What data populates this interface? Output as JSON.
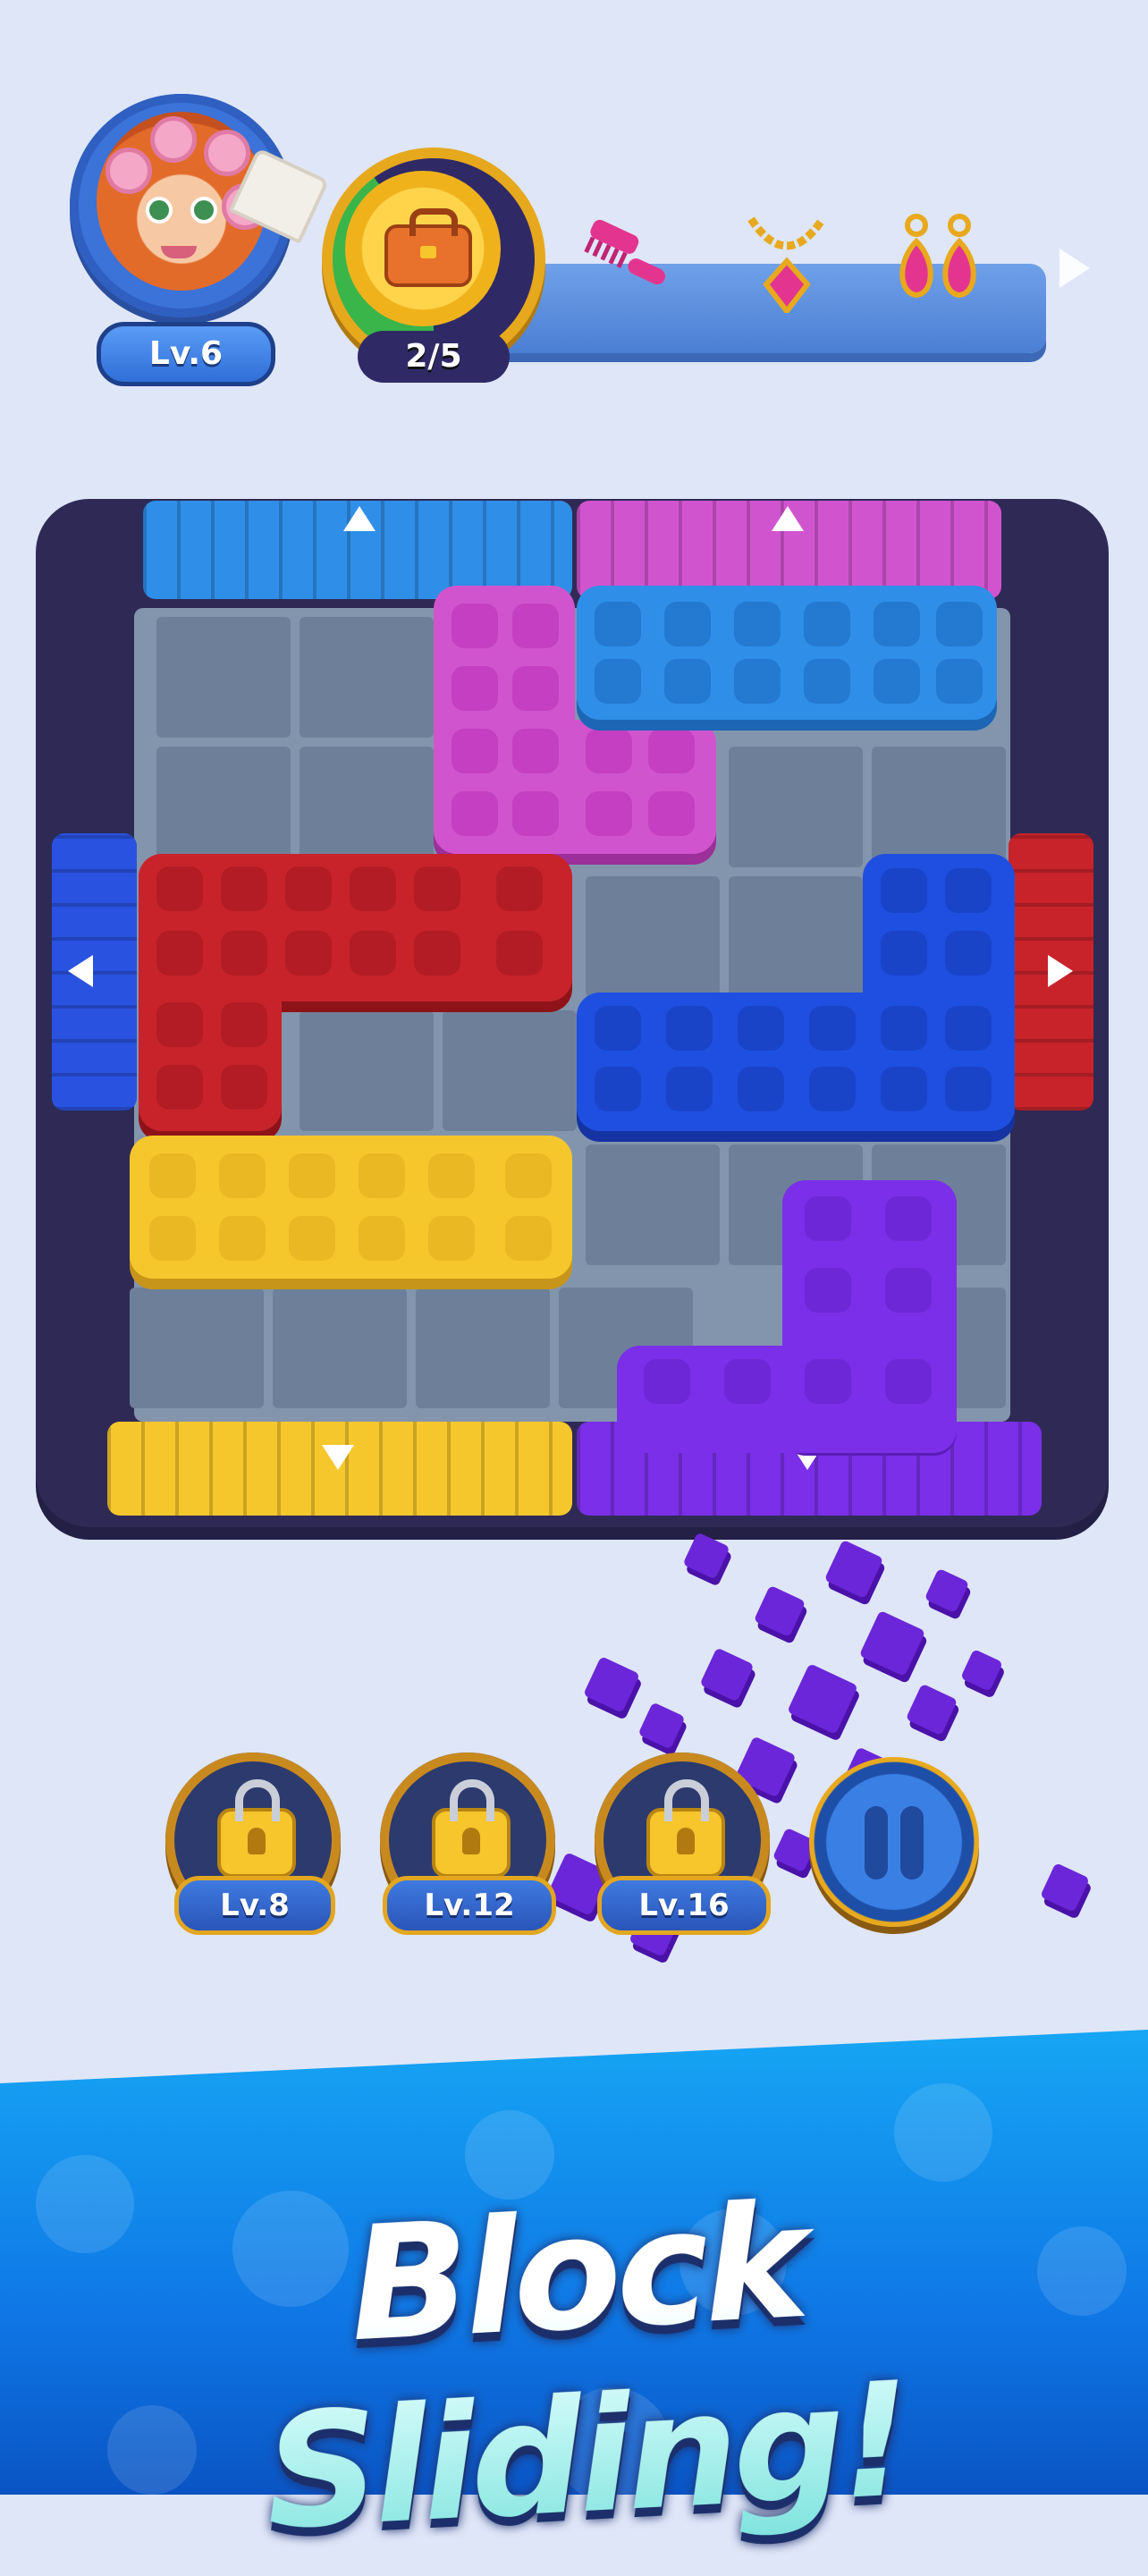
{
  "player": {
    "level_label": "Lv.6",
    "portrait_icon": "character-portrait-icon"
  },
  "collection": {
    "progress_text": "2/5",
    "progress_fraction": 0.4,
    "current_item_icon": "handbag-icon",
    "upcoming_items": [
      "comb-icon",
      "necklace-icon",
      "earrings-icon"
    ],
    "next_icon": "play-arrow-icon"
  },
  "board": {
    "colors": {
      "frame": "#2f2a55",
      "blue": "#2f8ee8",
      "pink": "#d154cf",
      "red": "#c8232b",
      "royal_blue": "#1e4fe0",
      "yellow": "#f6c72c",
      "purple": "#7b2fe8"
    },
    "gates": [
      "top-blue-up",
      "top-pink-up",
      "left-blue-left",
      "right-red-right",
      "bottom-yellow-down",
      "bottom-purple-down"
    ],
    "blocks": [
      "pink-L",
      "blue-bar",
      "red-L",
      "royal-blue-L",
      "yellow-bar",
      "purple-L"
    ]
  },
  "boosters": [
    {
      "label": "Lv.8",
      "icon": "padlock-icon"
    },
    {
      "label": "Lv.12",
      "icon": "padlock-icon"
    },
    {
      "label": "Lv.16",
      "icon": "padlock-icon"
    }
  ],
  "pause": {
    "icon": "pause-icon"
  },
  "banner": {
    "title": "Block Sliding!"
  }
}
